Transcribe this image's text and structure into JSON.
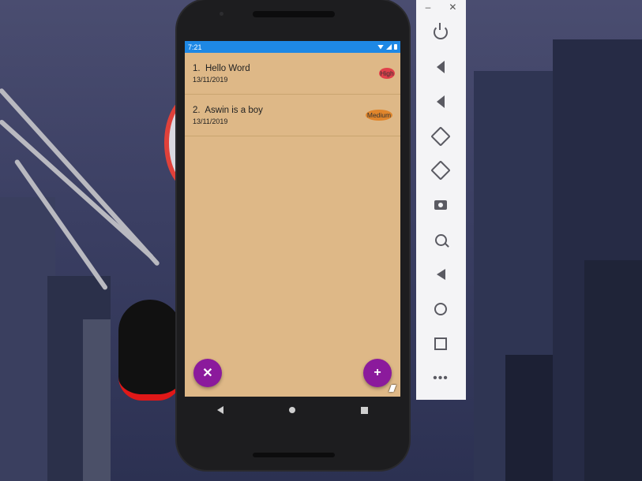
{
  "status_bar": {
    "time": "7:21"
  },
  "list": [
    {
      "index": "1.",
      "title": "Hello Word",
      "date": "13/11/2019",
      "priority": "High",
      "priority_color": "#e0404a"
    },
    {
      "index": "2.",
      "title": "Aswin is a boy",
      "date": "13/11/2019",
      "priority": "Medium",
      "priority_color": "#e0852b"
    }
  ],
  "fab_left": {
    "icon": "close-icon",
    "glyph": "✕"
  },
  "fab_right": {
    "icon": "add-icon",
    "glyph": "+"
  },
  "colors": {
    "screen_bg": "#deb887",
    "status_bar": "#1e88e5",
    "fab": "#8b1a9c"
  },
  "emulator_toolbar": {
    "window_buttons": [
      "–",
      "✕"
    ],
    "buttons": [
      "power-icon",
      "volume-up-icon",
      "volume-down-icon",
      "rotate-left-icon",
      "rotate-right-icon",
      "camera-icon",
      "zoom-icon",
      "back-icon",
      "home-icon",
      "overview-icon",
      "more-icon"
    ],
    "more_glyph": "•••"
  }
}
